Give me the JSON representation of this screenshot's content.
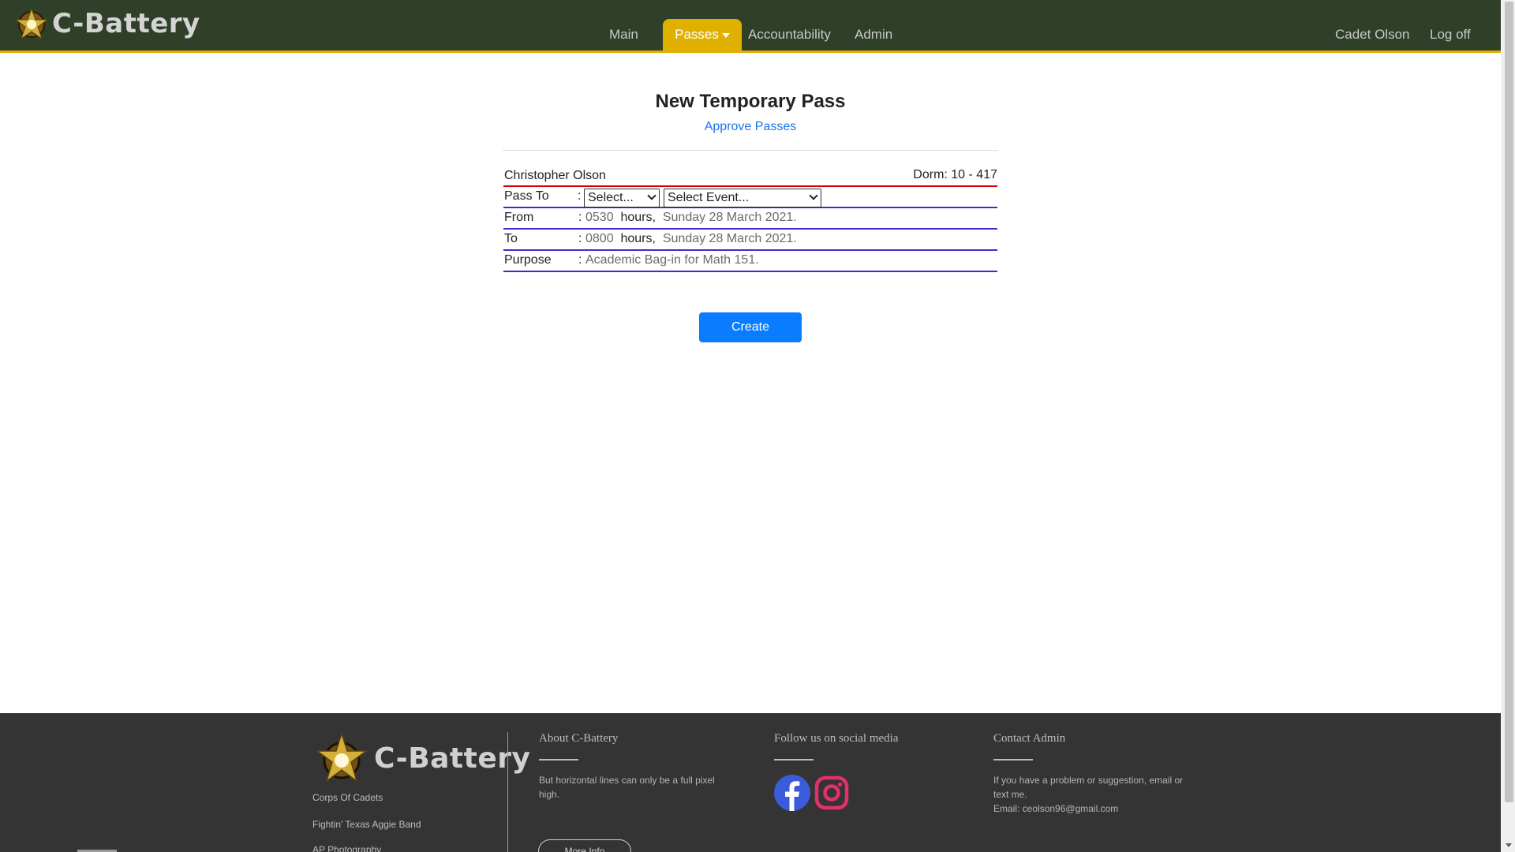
{
  "app": {
    "brand": "C-Battery"
  },
  "nav": {
    "main": "Main",
    "passes": "Passes",
    "accountability": "Accountability",
    "admin": "Admin",
    "user": "Cadet Olson",
    "logoff": "Log off"
  },
  "page": {
    "title": "New Temporary Pass",
    "approve_link": "Approve Passes"
  },
  "form": {
    "name": "Christopher Olson",
    "dorm": "Dorm: 10 - 417",
    "pass_to_label": "Pass To",
    "colon": ":",
    "select1": "Select...",
    "select2": "Select Event...",
    "from_label": "From",
    "from_time": "0530",
    "hours": "hours,",
    "from_date": "Sunday 28 March 2021.",
    "to_label": "To",
    "to_time": "0800",
    "to_date": "Sunday 28 March 2021.",
    "purpose_label": "Purpose",
    "purpose_value": "Academic Bag-in for Math 151.",
    "create": "Create"
  },
  "footer": {
    "link1": "Corps Of Cadets",
    "link2": "Fightin' Texas Aggie Band",
    "link3": "AP Photography",
    "about_head": "About C-Battery",
    "about_text": "But horizontal lines can only be a full pixel high.",
    "more_info": "More Info",
    "social_head": "Follow us on social media",
    "contact_head": "Contact Admin",
    "contact_text": "If you have a problem or suggestion, email or text me.",
    "contact_email": "Email: ceolson96@gmail.com"
  },
  "colors": {
    "nav_bg": "#2f3f28",
    "accent": "#e0b000",
    "primary": "#0a7cff",
    "facebook": "#3b5bdb",
    "instagram": "#e1306c",
    "footer_bg": "#343434"
  }
}
